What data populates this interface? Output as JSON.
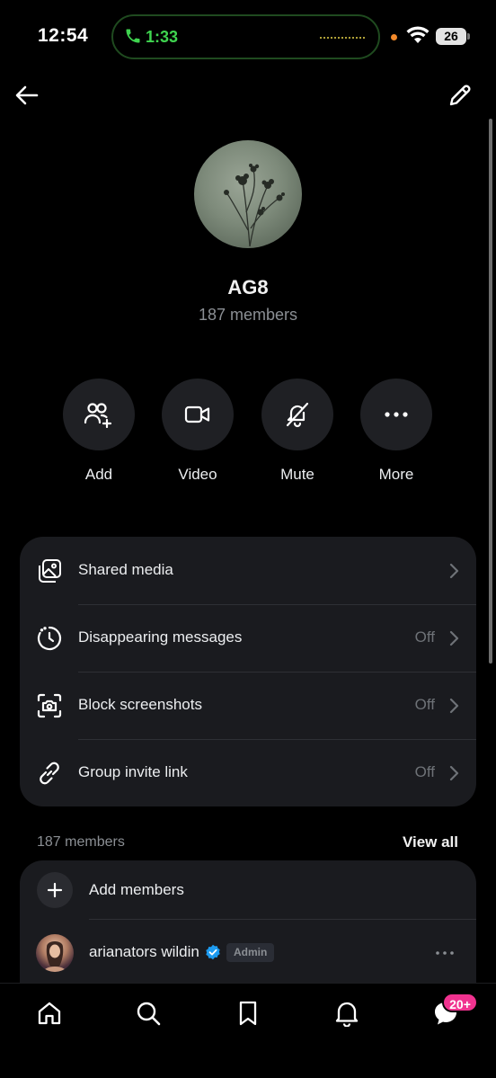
{
  "status_bar": {
    "time": "12:54",
    "call_duration": "1:33",
    "battery": "26"
  },
  "header": {
    "back_icon": "arrow-left-icon",
    "edit_icon": "pencil-icon"
  },
  "group": {
    "name": "AG8",
    "member_count_label": "187 members"
  },
  "actions": [
    {
      "label": "Add",
      "icon": "add-people-icon"
    },
    {
      "label": "Video",
      "icon": "video-camera-icon"
    },
    {
      "label": "Mute",
      "icon": "bell-off-icon"
    },
    {
      "label": "More",
      "icon": "more-horizontal-icon"
    }
  ],
  "settings": [
    {
      "label": "Shared media",
      "value": "",
      "icon": "shared-media-icon"
    },
    {
      "label": "Disappearing messages",
      "value": "Off",
      "icon": "timer-icon"
    },
    {
      "label": "Block screenshots",
      "value": "Off",
      "icon": "screenshot-icon"
    },
    {
      "label": "Group invite link",
      "value": "Off",
      "icon": "link-icon"
    }
  ],
  "members": {
    "heading": "187 members",
    "view_all": "View all",
    "add_label": "Add members",
    "list": [
      {
        "name": "arianators wildin",
        "verified": true,
        "badge": "Admin"
      }
    ]
  },
  "bottom_nav": {
    "items": [
      "home-icon",
      "search-icon",
      "bookmark-icon",
      "bell-icon",
      "messages-icon"
    ],
    "messages_badge": "20+"
  },
  "colors": {
    "background": "#000000",
    "card": "#1a1b1f",
    "badge": "#f0328f",
    "verified": "#1d9bf0",
    "call_green": "#3fd44f"
  }
}
